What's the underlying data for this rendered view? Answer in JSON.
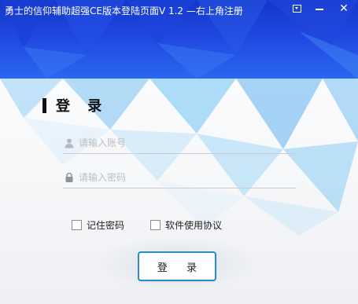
{
  "window": {
    "title": "勇士的信仰辅助超强CE版本登陆页面V 1.2 —右上角注册",
    "menu_icon": "dropdown-menu-icon",
    "minimize_icon": "minimize-icon",
    "close_icon": "close-icon",
    "close_glyph": "✕"
  },
  "login": {
    "heading": "登 录",
    "account_placeholder": "请输入账号",
    "password_placeholder": "请输入密码",
    "remember_label": "记住密码",
    "agreement_label": "软件使用协议",
    "submit_label": "登 录"
  },
  "colors": {
    "title_blue": "#1436c8",
    "accent_blue": "#2b8dc6",
    "background": "#f4f6f9"
  }
}
